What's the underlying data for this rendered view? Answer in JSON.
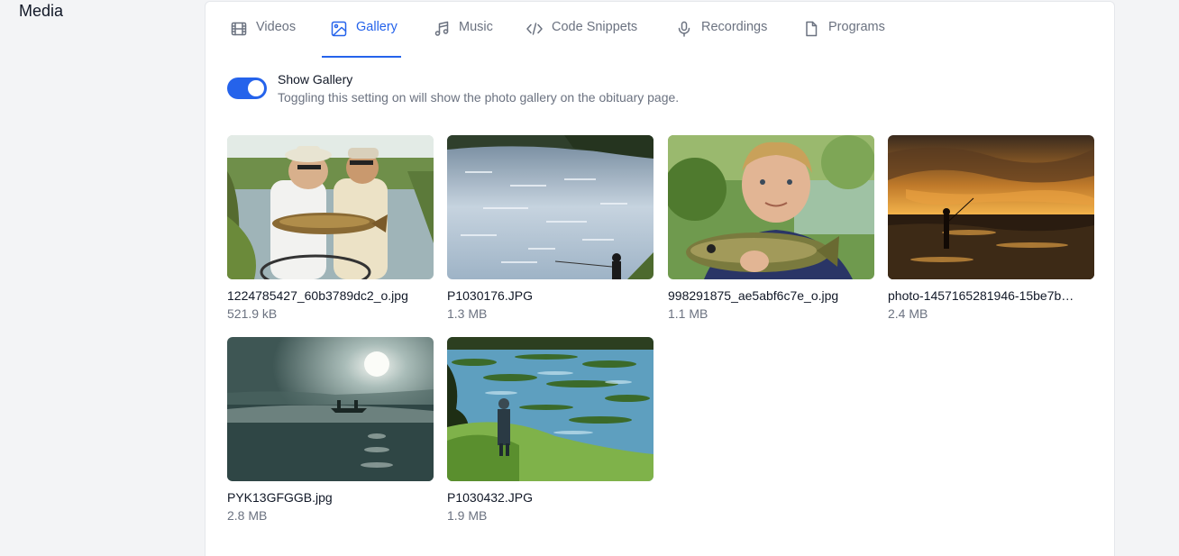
{
  "section": {
    "title": "Media"
  },
  "tabs": [
    {
      "label": "Videos",
      "icon": "film-icon",
      "active": false
    },
    {
      "label": "Gallery",
      "icon": "image-icon",
      "active": true
    },
    {
      "label": "Music",
      "icon": "music-note-icon",
      "active": false
    },
    {
      "label": "Code Snippets",
      "icon": "code-icon",
      "active": false
    },
    {
      "label": "Recordings",
      "icon": "microphone-icon",
      "active": false
    },
    {
      "label": "Programs",
      "icon": "document-icon",
      "active": false
    }
  ],
  "gallery_toggle": {
    "label": "Show Gallery",
    "description": "Toggling this setting on will show the photo gallery on the obituary page.",
    "enabled": true
  },
  "photos": [
    {
      "name": "1224785427_60b3789dc2_o.jpg",
      "size": "521.9 kB"
    },
    {
      "name": "P1030176.JPG",
      "size": "1.3 MB"
    },
    {
      "name": "998291875_ae5abf6c7e_o.jpg",
      "size": "1.1 MB"
    },
    {
      "name": "photo-1457165281946-15be7b…",
      "size": "2.4 MB"
    },
    {
      "name": "PYK13GFGGB.jpg",
      "size": "2.8 MB"
    },
    {
      "name": "P1030432.JPG",
      "size": "1.9 MB"
    }
  ],
  "colors": {
    "accent": "#2563eb",
    "muted": "#6b7280",
    "background": "#f3f4f6"
  }
}
